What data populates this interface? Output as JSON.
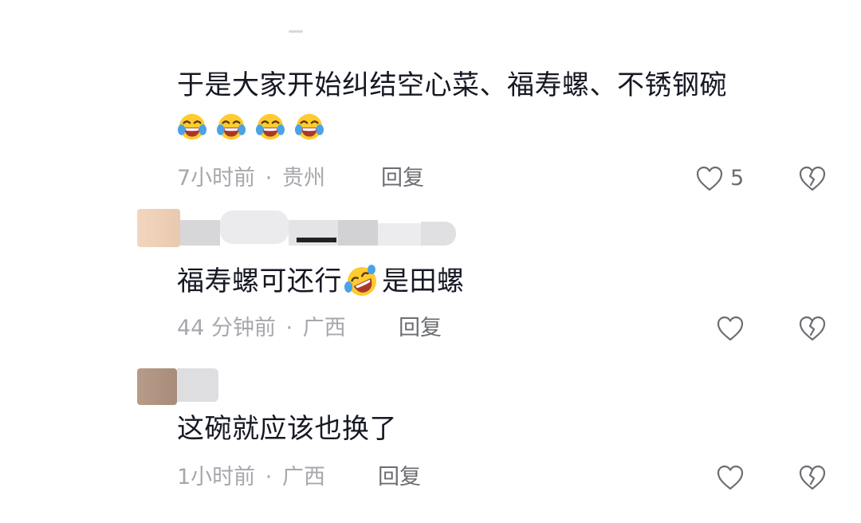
{
  "comments": [
    {
      "text_before": "于是大家开始纠结空心菜、福寿螺、不锈钢碗",
      "emoji_count": 4,
      "emoji": "face-with-tears-of-joy-icon",
      "time": "7小时前",
      "location": "贵州",
      "reply": "回复",
      "likes": "5"
    },
    {
      "text_before": "福寿螺可还行",
      "emoji": "rolling-on-floor-laughing-icon",
      "text_after": "是田螺",
      "time": "44 分钟前",
      "location": "广西",
      "reply": "回复"
    },
    {
      "text_before": "这碗就应该也换了",
      "time": "1小时前",
      "location": "广西",
      "reply": "回复"
    }
  ],
  "separator": "·",
  "colors": {
    "text": "#161823",
    "meta": "#a6a8ad",
    "action": "#6b6d72",
    "emoji_yellow": "#ffcb2f",
    "emoji_tear": "#4aa3e8"
  }
}
